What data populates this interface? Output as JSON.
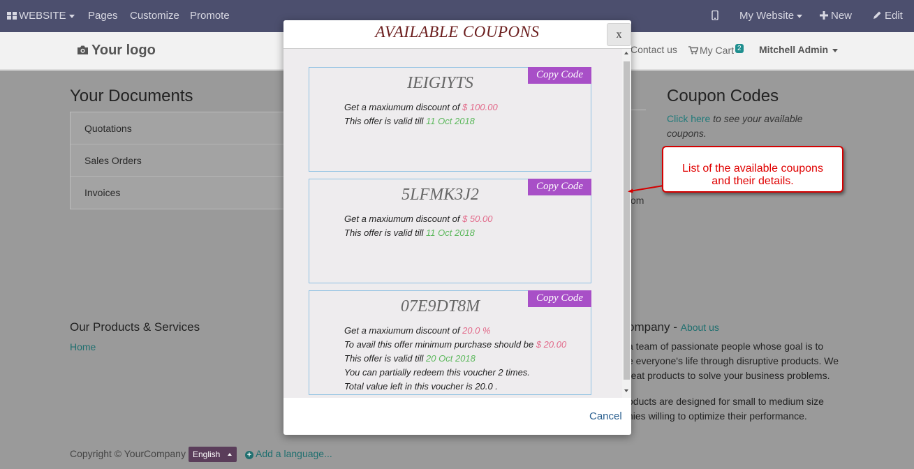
{
  "topbar": {
    "website": "WEBSITE",
    "pages": "Pages",
    "customize": "Customize",
    "promote": "Promote",
    "my_website": "My Website",
    "new": "New",
    "edit": "Edit"
  },
  "header": {
    "logo": "Your logo",
    "contact": "Contact us",
    "cart": "My Cart",
    "cart_count": "2",
    "user": "Mitchell Admin"
  },
  "documents": {
    "title": "Your Documents",
    "items": [
      "Quotations",
      "Sales Orders",
      "Invoices"
    ]
  },
  "coupon_codes": {
    "title": "Coupon Codes",
    "link": "Click here",
    "text": "to see your available coupons.",
    "fragment": "om"
  },
  "footer": {
    "products_title": "Our Products & Services",
    "home": "Home",
    "company_title": "ompany -",
    "about": "About us",
    "para1": [
      "a team of passionate people whose goal is to",
      "e everyone's life through disruptive products. We",
      "reat products to solve your business problems."
    ],
    "para2": [
      "oducts are designed for small to medium size",
      "nies willing to optimize their performance."
    ],
    "copyright": "Copyright © YourCompany",
    "language": "English",
    "add_language": "Add a language..."
  },
  "modal": {
    "title": "AVAILABLE COUPONS",
    "close": "x",
    "copy_label": "Copy Code",
    "cancel": "Cancel",
    "coupons": [
      {
        "code": "IEIGIYTS",
        "l1": "Get a maxiumum discount of ",
        "l1v": "$ 100.00",
        "l2": "This offer is valid till ",
        "l2v": "11 Oct 2018"
      },
      {
        "code": "5LFMK3J2",
        "l1": "Get a maxiumum discount of ",
        "l1v": "$ 50.00",
        "l2": "This offer is valid till ",
        "l2v": "11 Oct 2018"
      },
      {
        "code": "07E9DT8M",
        "l1": "Get a maxiumum discount of ",
        "l1v": "20.0 %",
        "l3": "To avail this offer minimum purchase should be ",
        "l3v": "$ 20.00",
        "l2": "This offer is valid till ",
        "l2v": "20 Oct 2018",
        "l4": "You can partially redeem this voucher 2 times.",
        "l5": "Total value left in this voucher is 20.0 ."
      }
    ]
  },
  "annotation": {
    "line1": "List of the available coupons",
    "line2": "and their details."
  },
  "colors": {
    "topbar": "#4c4f6e",
    "copy_button": "#a84fc7",
    "title": "#6b1d1d",
    "amount": "#e26a8a",
    "date": "#5cb85c",
    "annotation": "#d40000"
  }
}
